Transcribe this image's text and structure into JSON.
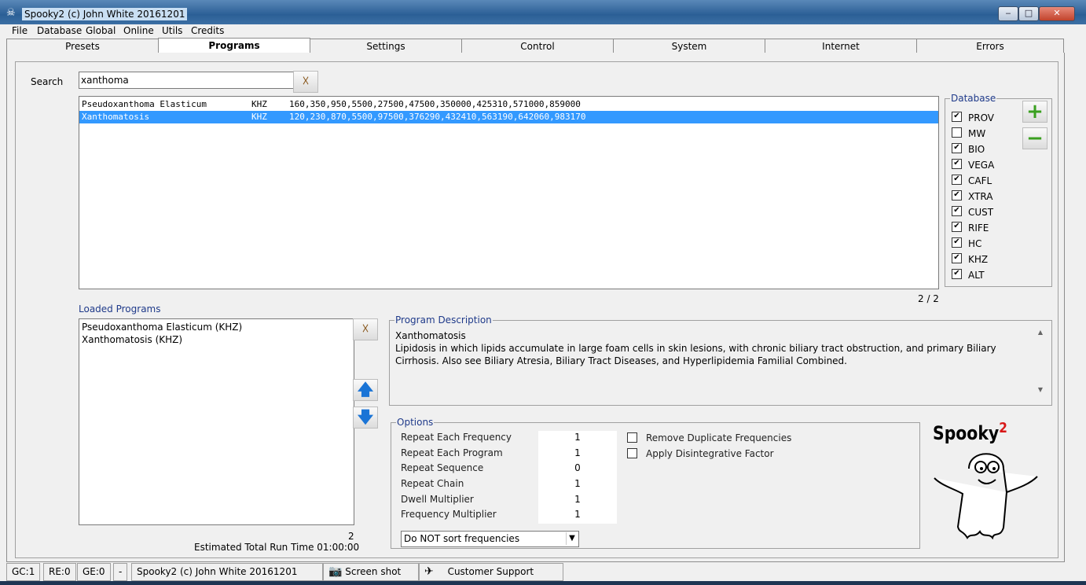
{
  "window": {
    "title": "Spooky2 (c) John White 20161201",
    "min": "‒",
    "max": "□",
    "close": "✕"
  },
  "menu": [
    "File",
    "Database",
    "Global",
    "Online",
    "Utils",
    "Credits"
  ],
  "tabs": [
    "Presets",
    "Programs",
    "Settings",
    "Control",
    "System",
    "Internet",
    "Errors"
  ],
  "active_tab": "Programs",
  "search": {
    "label": "Search",
    "value": "xanthoma"
  },
  "results": [
    {
      "name": "Pseudoxanthoma Elasticum",
      "db": "KHZ",
      "freqs": "160,350,950,5500,27500,47500,350000,425310,571000,859000",
      "selected": false
    },
    {
      "name": "Xanthomatosis",
      "db": "KHZ",
      "freqs": "120,230,870,5500,97500,376290,432410,563190,642060,983170",
      "selected": true
    }
  ],
  "result_count": "2 / 2",
  "database": {
    "title": "Database",
    "items": [
      {
        "label": "PROV",
        "checked": true
      },
      {
        "label": "MW",
        "checked": false
      },
      {
        "label": "BIO",
        "checked": true
      },
      {
        "label": "VEGA",
        "checked": true
      },
      {
        "label": "CAFL",
        "checked": true
      },
      {
        "label": "XTRA",
        "checked": true
      },
      {
        "label": "CUST",
        "checked": true
      },
      {
        "label": "RIFE",
        "checked": true
      },
      {
        "label": "HC",
        "checked": true
      },
      {
        "label": "KHZ",
        "checked": true
      },
      {
        "label": "ALT",
        "checked": true
      }
    ]
  },
  "loaded": {
    "title": "Loaded Programs",
    "items": [
      "Pseudoxanthoma Elasticum (KHZ)",
      "Xanthomatosis (KHZ)"
    ],
    "count": "2",
    "runtime": "Estimated Total Run Time 01:00:00"
  },
  "description": {
    "title": "Program Description",
    "heading": "Xanthomatosis",
    "text": "Lipidosis in which lipids accumulate in large foam cells in skin lesions, with chronic biliary tract obstruction, and primary Biliary Cirrhosis. Also see Biliary Atresia, Biliary Tract Diseases, and Hyperlipidemia Familial Combined."
  },
  "options": {
    "title": "Options",
    "rows": [
      {
        "label": "Repeat Each Frequency",
        "value": "1"
      },
      {
        "label": "Repeat Each Program",
        "value": "1"
      },
      {
        "label": "Repeat Sequence",
        "value": "0"
      },
      {
        "label": "Repeat Chain",
        "value": "1"
      },
      {
        "label": "Dwell Multiplier",
        "value": "1"
      },
      {
        "label": "Frequency Multiplier",
        "value": "1"
      }
    ],
    "checks": [
      {
        "label": "Remove Duplicate Frequencies",
        "checked": false
      },
      {
        "label": "Apply Disintegrative Factor",
        "checked": false
      }
    ],
    "sort": "Do NOT sort frequencies"
  },
  "logo": {
    "text": "Spooky",
    "sup": "2"
  },
  "status": [
    "GC:1",
    "RE:0",
    "GE:0",
    "-",
    "Spooky2 (c) John White 20161201"
  ],
  "screenshot_label": "Screen shot",
  "support_label": "Customer Support"
}
